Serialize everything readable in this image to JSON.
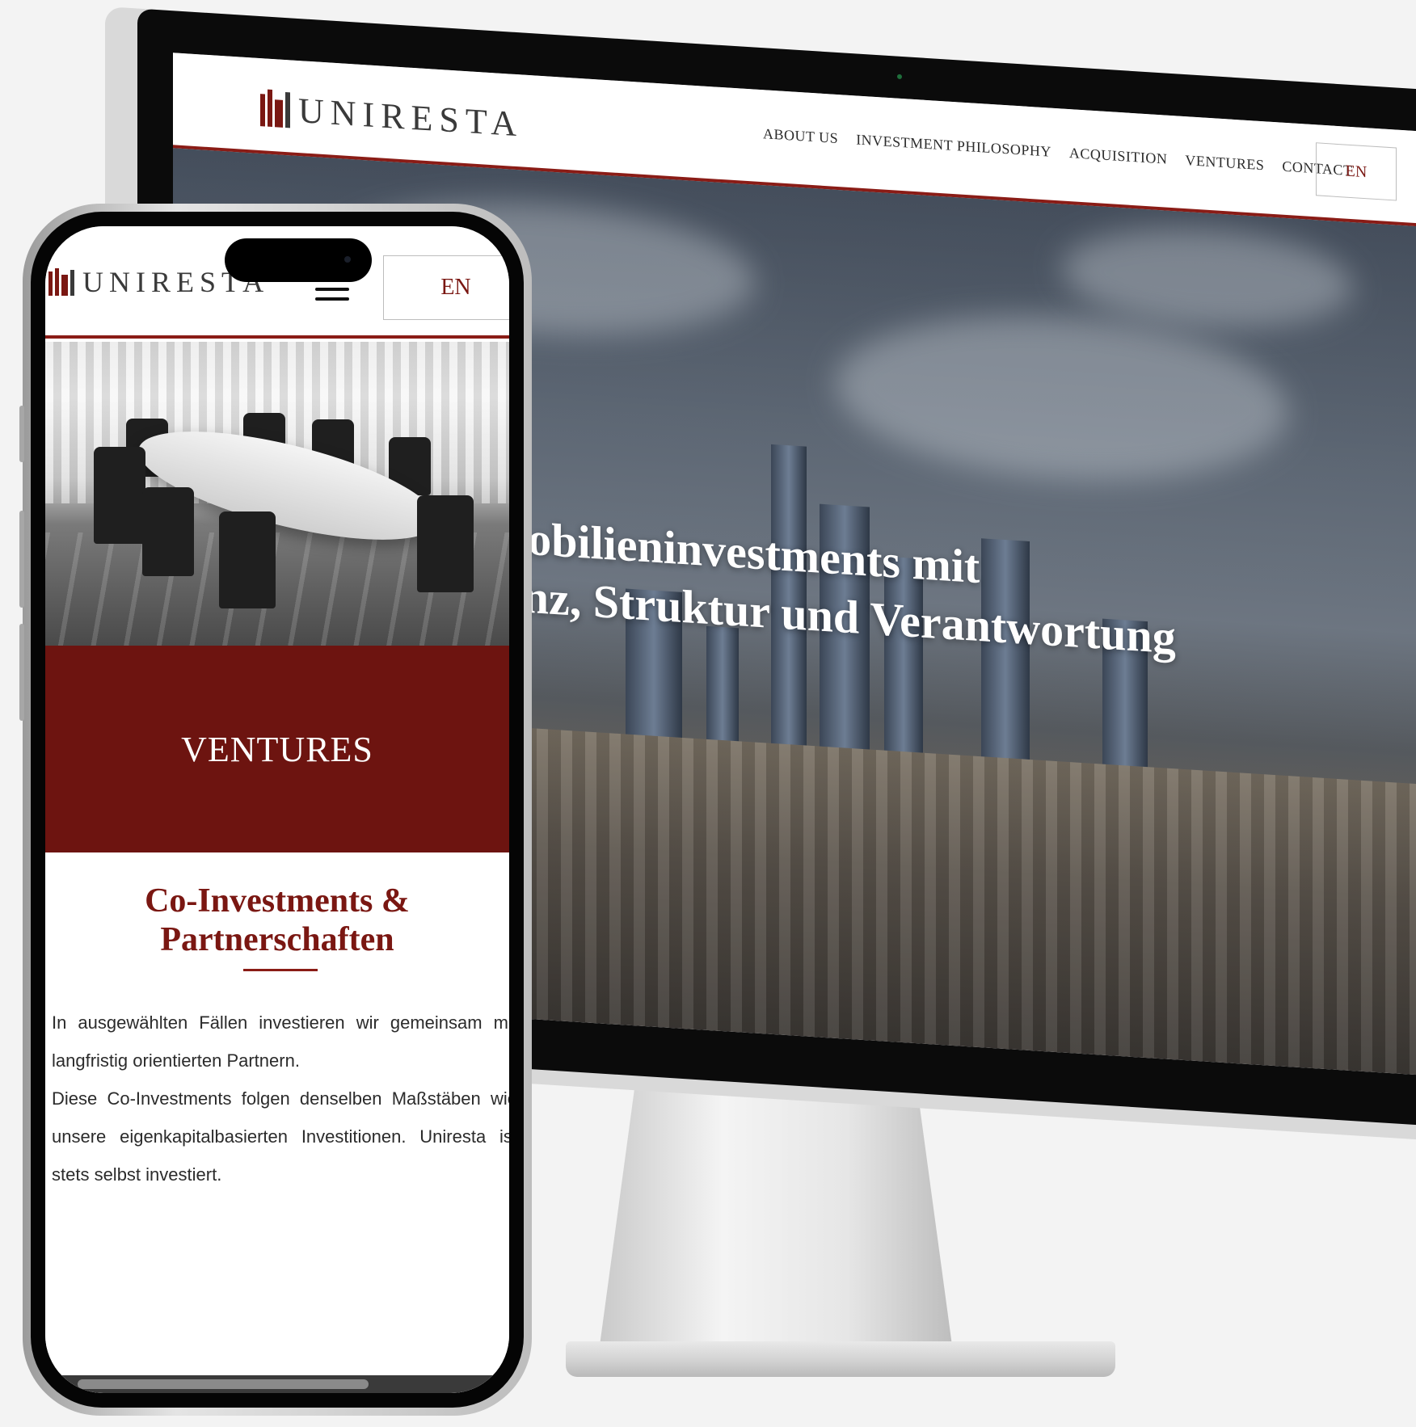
{
  "brand": {
    "name": "UNIRESTA",
    "accent_color": "#7a1712",
    "banner_color": "#6d1410"
  },
  "desktop": {
    "nav": {
      "items": [
        "ABOUT US",
        "INVESTMENT PHILOSOPHY",
        "ACQUISITION",
        "VENTURES",
        "CONTACT"
      ]
    },
    "language_label": "EN",
    "hero": {
      "line1": "Immobilieninvestments mit",
      "line2": "Finanz, Struktur und Verantwortung"
    }
  },
  "mobile": {
    "language_label": "EN",
    "menu_icon": "hamburger-icon",
    "banner_title": "VENTURES",
    "section": {
      "title_line1": "Co-Investments &",
      "title_line2": "Partnerschaften",
      "paragraph1": "In ausgewählten Fällen investieren wir gemeinsam mit langfristig orientierten Partnern.",
      "paragraph2": "Diese Co-Investments folgen denselben Maßstäben wie unsere eigenkapitalbasierten Investitionen. Uniresta ist stets selbst investiert."
    }
  }
}
